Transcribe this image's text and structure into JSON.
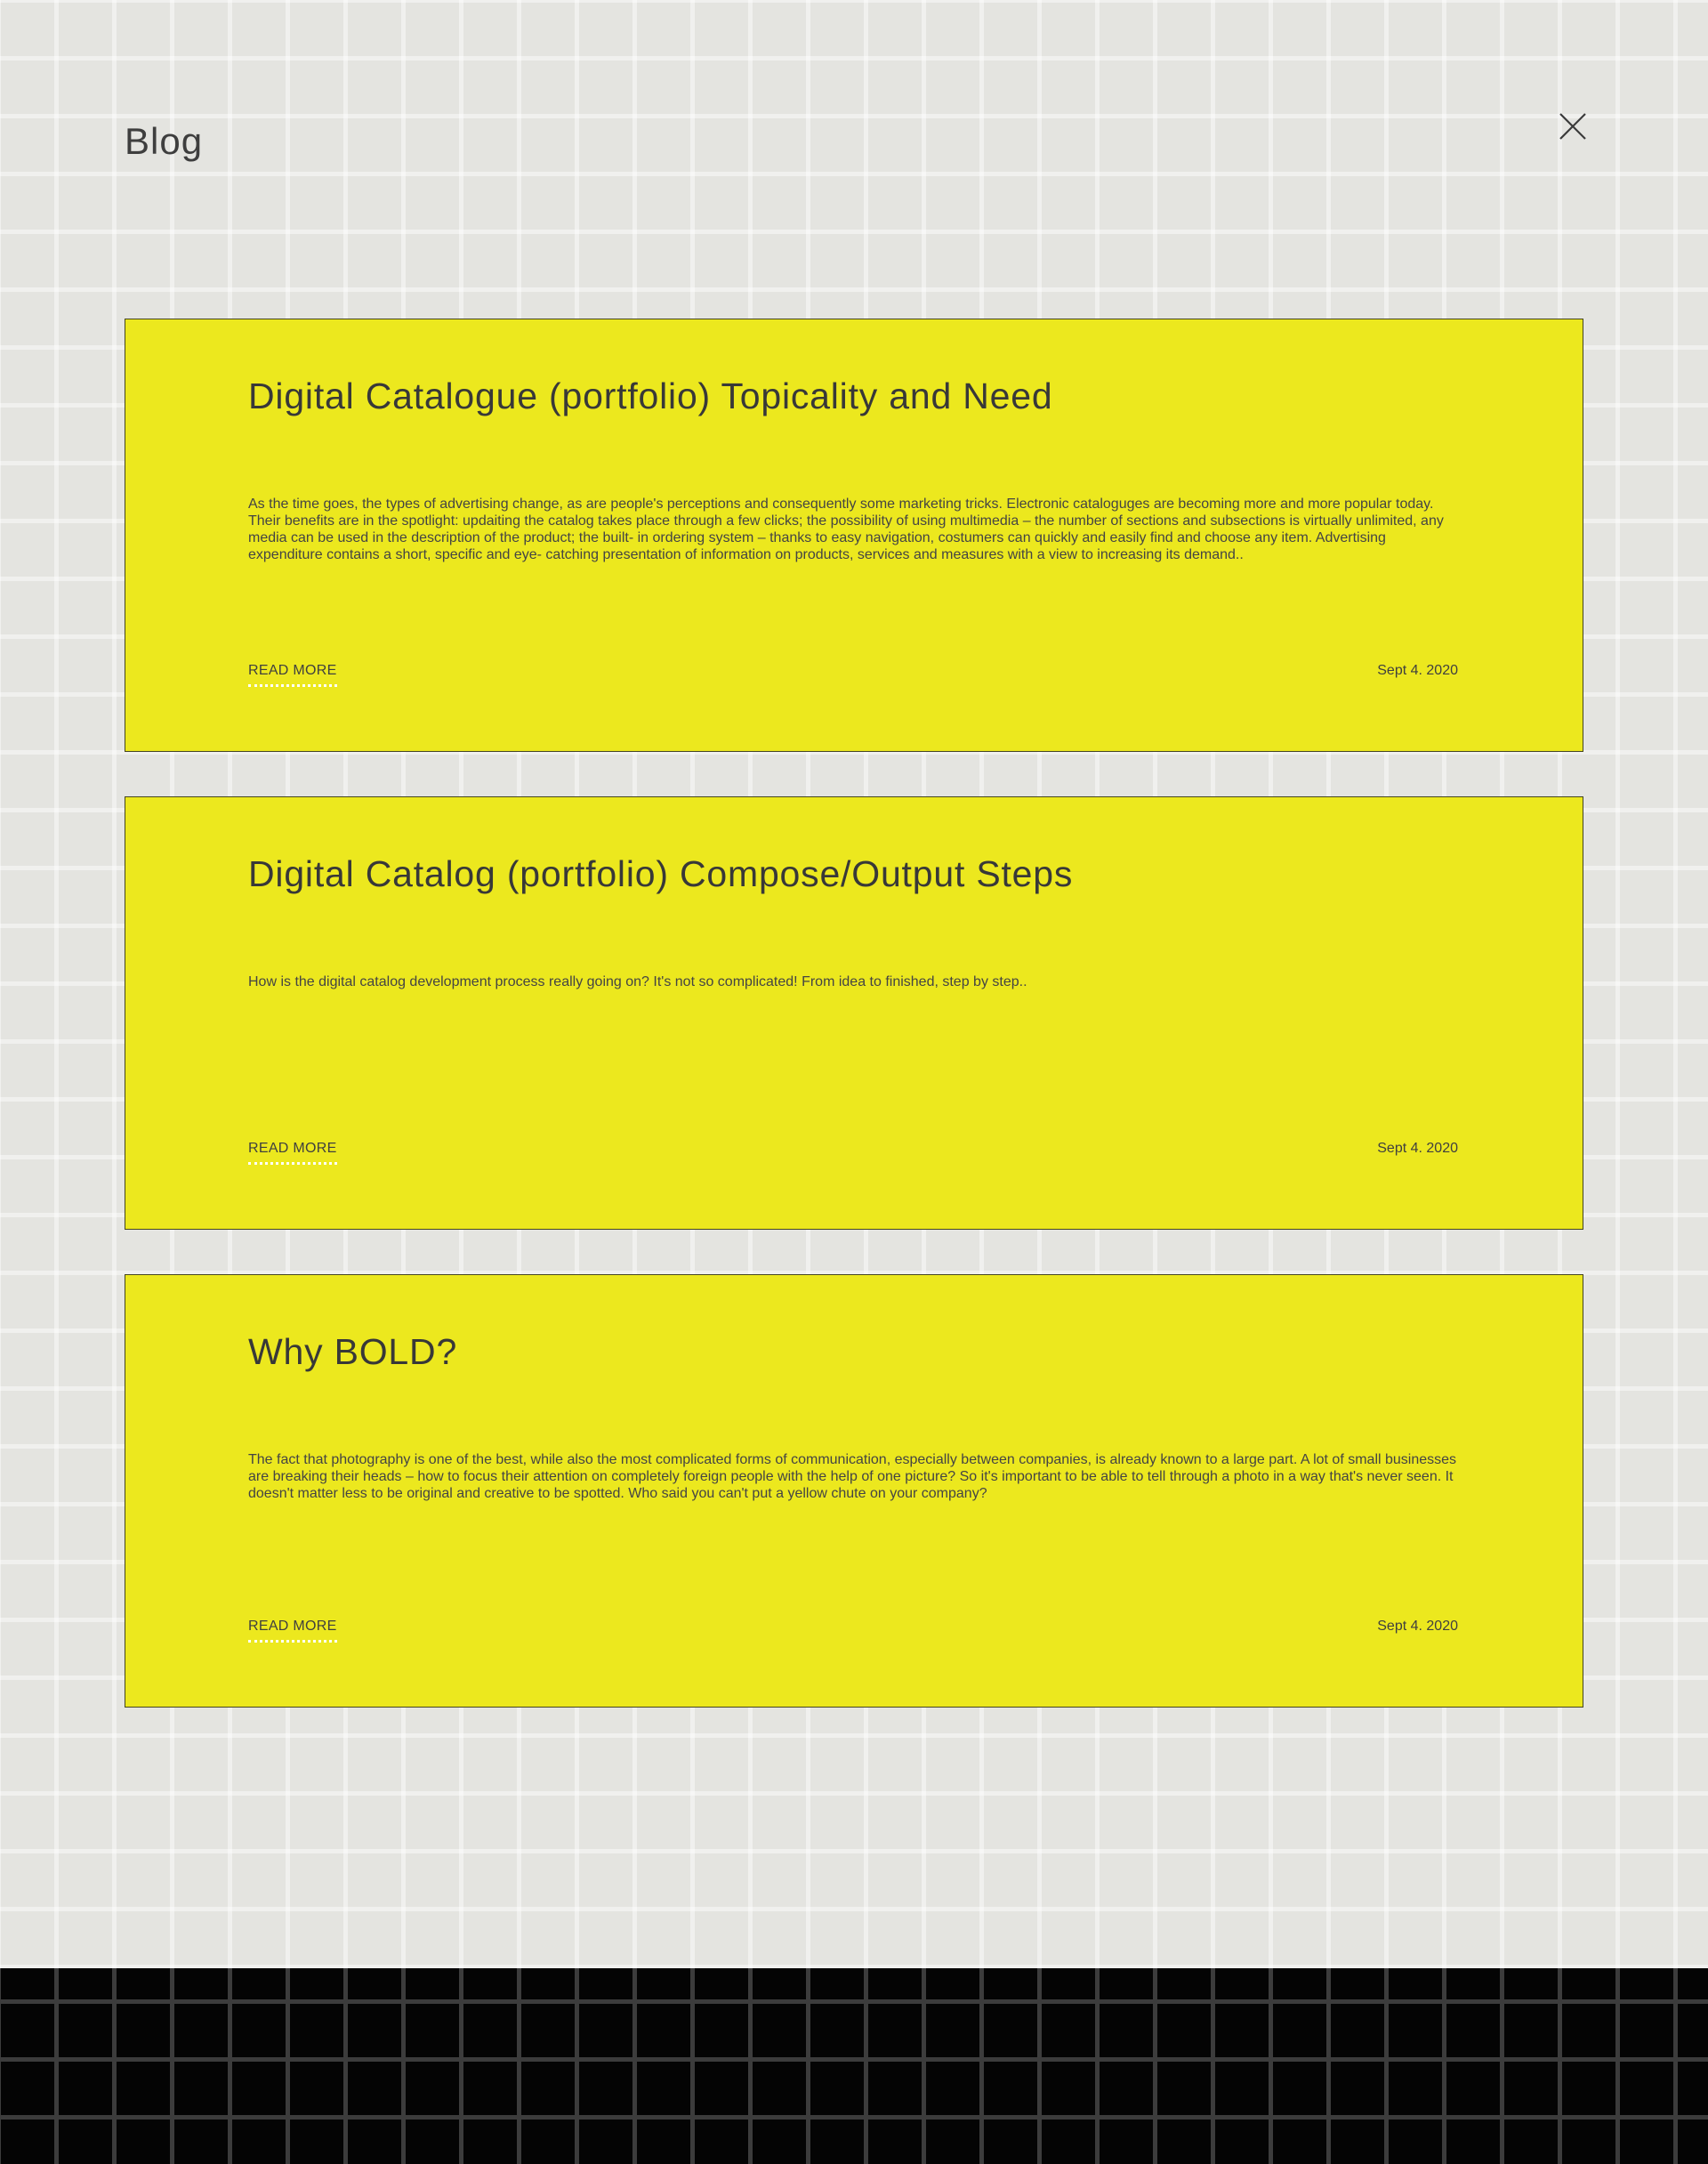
{
  "page": {
    "title": "Blog",
    "close_icon": "close-icon"
  },
  "posts": [
    {
      "title": "Digital Catalogue (portfolio) Topicality and Need",
      "excerpt": "As the time goes, the types of advertising change, as are people's perceptions and consequently some marketing tricks. Electronic cataloguges are becoming more and more popular today. Their benefits are in the spotlight: updaiting the catalog takes place through a few clicks; the possibility of using multimedia – the number of sections and subsections is virtually unlimited, any media can be used in the description of the product; the built- in ordering system – thanks to easy navigation, costumers can quickly and easily find and choose any item. Advertising expenditure contains a short, specific and eye- catching presentation of information on products, services and measures with a view to increasing its demand..",
      "read_more": "READ MORE",
      "date": "Sept 4. 2020"
    },
    {
      "title": "Digital Catalog (portfolio) Compose/Output Steps",
      "excerpt": "How is the digital catalog development process really going on? It's not so complicated! From idea to finished, step by step..",
      "read_more": "READ MORE",
      "date": "Sept 4. 2020"
    },
    {
      "title": "Why BOLD?",
      "excerpt": "The fact that photography is one of the best, while also the most complicated forms of communication, especially between companies, is already known to a large part. A lot of small businesses are breaking their heads – how to focus their attention on completely foreign people with the help of one picture? So it's important to be able to tell through a photo in a way that's never seen. It doesn't matter less to be original and creative to be spotted. Who said you can't put a yellow chute on your company?",
      "read_more": "READ MORE",
      "date": "Sept 4. 2020"
    }
  ],
  "colors": {
    "card_background": "#ece81e",
    "page_background": "#e4e4e0",
    "footer_background": "#040404",
    "text": "#3a3a3a"
  }
}
